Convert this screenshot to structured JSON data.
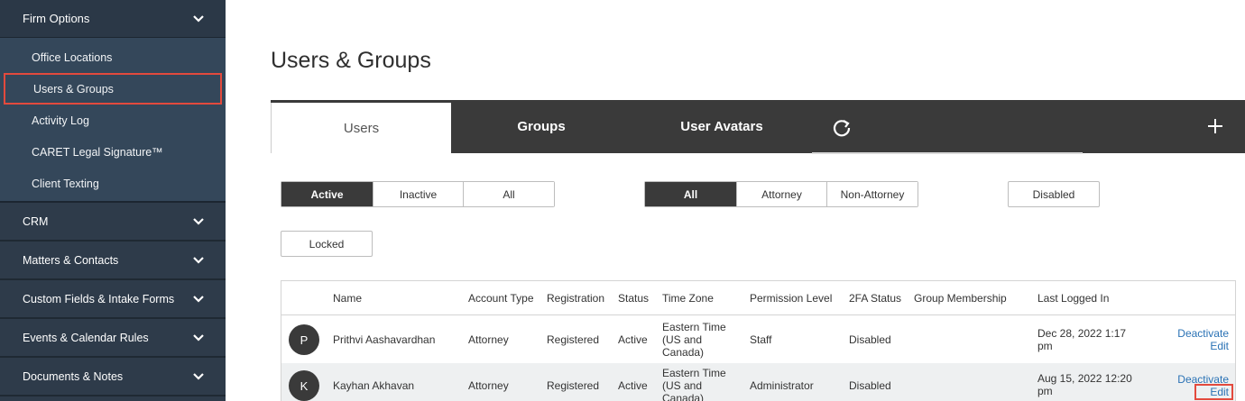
{
  "sidebar": {
    "firm_options": "Firm Options",
    "sub_items": [
      "Office Locations",
      "Users & Groups",
      "Activity Log",
      "CARET Legal Signature™",
      "Client Texting"
    ],
    "sections": [
      "CRM",
      "Matters & Contacts",
      "Custom Fields & Intake Forms",
      "Events & Calendar Rules",
      "Documents & Notes"
    ]
  },
  "page": {
    "title": "Users & Groups"
  },
  "tabs": [
    "Users",
    "Groups",
    "User Avatars"
  ],
  "filters": {
    "status": [
      "Active",
      "Inactive",
      "All"
    ],
    "type": [
      "All",
      "Attorney",
      "Non-Attorney"
    ],
    "disabled": "Disabled",
    "locked": "Locked"
  },
  "table": {
    "headers": [
      "Name",
      "Account Type",
      "Registration",
      "Status",
      "Time Zone",
      "Permission Level",
      "2FA Status",
      "Group Membership",
      "Last Logged In"
    ],
    "rows": [
      {
        "initial": "P",
        "name": "Prithvi Aashavardhan",
        "account_type": "Attorney",
        "registration": "Registered",
        "status": "Active",
        "tz1": "Eastern Time",
        "tz2": "(US and",
        "tz3": "Canada)",
        "permission": "Staff",
        "twofa": "Disabled",
        "last1": "Dec 28, 2022 1:17",
        "last2": "pm",
        "deactivate": "Deactivate",
        "edit": "Edit"
      },
      {
        "initial": "K",
        "name": "Kayhan Akhavan",
        "account_type": "Attorney",
        "registration": "Registered",
        "status": "Active",
        "tz1": "Eastern Time",
        "tz2": "(US and",
        "tz3": "Canada)",
        "permission": "Administrator",
        "twofa": "Disabled",
        "last1": "Aug 15, 2022 12:20",
        "last2": "pm",
        "deactivate": "Deactivate",
        "edit": "Edit"
      }
    ]
  },
  "colors": {
    "sidebar": "#2e3b4a",
    "tabbar": "#3a3a3a",
    "highlight": "#e34a3d",
    "link": "#2a72b5"
  }
}
